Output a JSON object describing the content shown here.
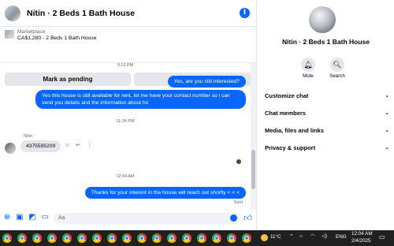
{
  "chat": {
    "title": "Nitin · 2 Beds 1 Bath House",
    "marketplace_label": "Marketplace",
    "listing": "CA$1,280 - 2 Beds 1 Bath House",
    "mark_pending_label": "Mark as pending",
    "more_options_label": "More options",
    "messages": [
      {
        "type": "time",
        "text": "9:12 PM"
      },
      {
        "type": "outgoing",
        "text": "Yes, are you still interested?"
      },
      {
        "type": "outgoing",
        "text": "Yes this house is still available for rent, let me have your contact number so i can send you details and the information about ho"
      },
      {
        "type": "time",
        "text": "11:34 PM"
      },
      {
        "type": "sender",
        "text": "Nitin"
      },
      {
        "type": "incoming",
        "text": "4375595209"
      },
      {
        "type": "time",
        "text": "12:04 AM"
      },
      {
        "type": "outgoing",
        "text": "Thanks for your interest in the house will reach out shortly  < < <"
      },
      {
        "type": "status",
        "text": "Sent"
      }
    ],
    "composer_placeholder": "Aa"
  },
  "sidebar": {
    "title": "Nitin · 2 Beds 1 Bath House",
    "mute_label": "Mute",
    "search_label": "Search",
    "sections": [
      "Customize chat",
      "Chat members",
      "Media, files and links",
      "Privacy & support"
    ]
  },
  "taskbar": {
    "temperature": "11°C",
    "language": "ENG",
    "time": "12:04 AM",
    "date": "2/4/2025"
  },
  "colors": {
    "accent": "#0866ff",
    "bubble_in": "#e4e6eb",
    "taskbar": "#202020"
  }
}
